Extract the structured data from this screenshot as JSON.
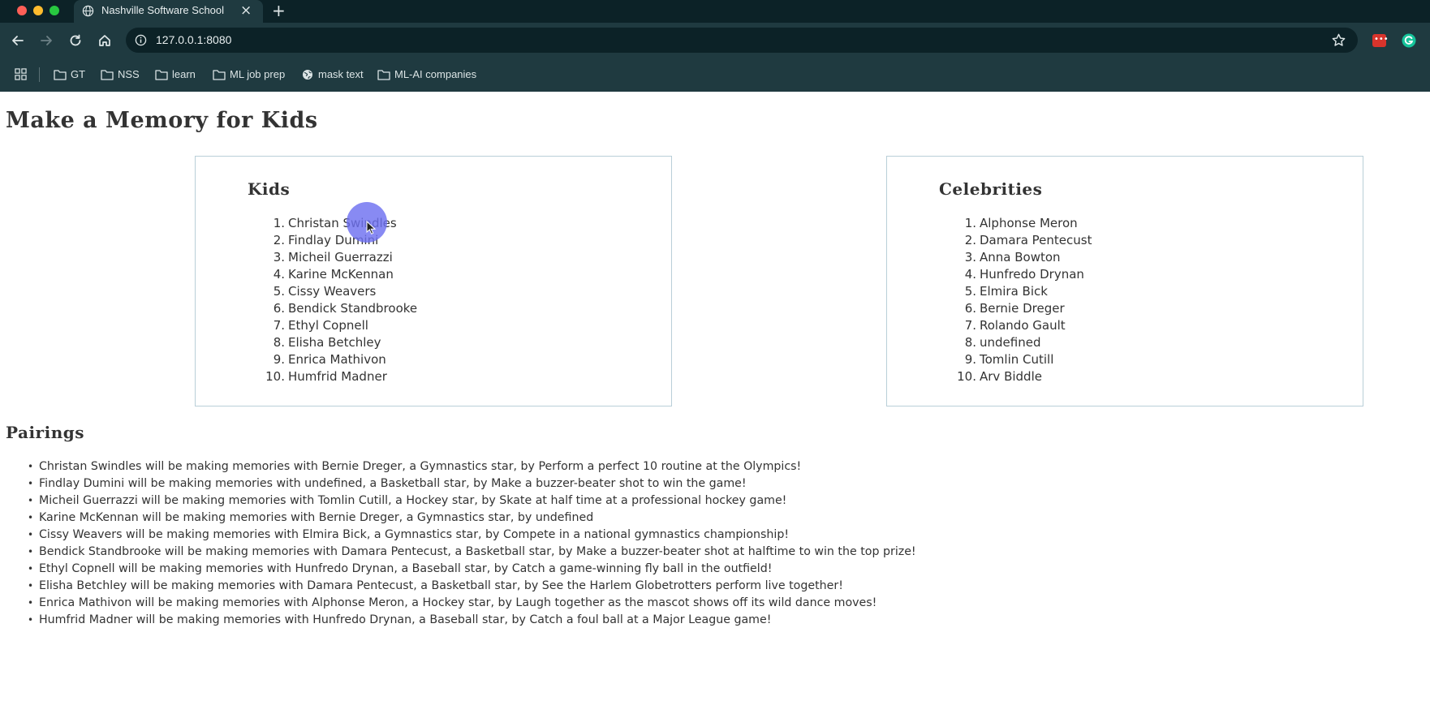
{
  "browser": {
    "tab": {
      "title": "Nashville Software School",
      "close_glyph": "×",
      "icon": "globe-icon"
    },
    "new_tab_glyph": "+",
    "address": {
      "url": "127.0.0.1:8080",
      "icon": "info-icon"
    },
    "bookmarks": [
      {
        "label": "GT",
        "icon": "folder-icon"
      },
      {
        "label": "NSS",
        "icon": "folder-icon"
      },
      {
        "label": "learn",
        "icon": "folder-icon"
      },
      {
        "label": "ML job prep",
        "icon": "folder-icon"
      },
      {
        "label": "mask text",
        "icon": "globe-icon"
      },
      {
        "label": "ML-AI companies",
        "icon": "folder-icon"
      }
    ],
    "extension_glyph": "•••"
  },
  "page": {
    "title": "Make a Memory for Kids",
    "kids": {
      "heading": "Kids",
      "items": [
        {
          "num": "1.",
          "name": "Christan Swindles"
        },
        {
          "num": "2.",
          "name": "Findlay Dumini"
        },
        {
          "num": "3.",
          "name": "Micheil Guerrazzi"
        },
        {
          "num": "4.",
          "name": "Karine McKennan"
        },
        {
          "num": "5.",
          "name": "Cissy Weavers"
        },
        {
          "num": "6.",
          "name": "Bendick Standbrooke"
        },
        {
          "num": "7.",
          "name": "Ethyl Copnell"
        },
        {
          "num": "8.",
          "name": "Elisha Betchley"
        },
        {
          "num": "9.",
          "name": "Enrica Mathivon"
        },
        {
          "num": "10.",
          "name": "Humfrid Madner"
        }
      ]
    },
    "celebrities": {
      "heading": "Celebrities",
      "items": [
        {
          "num": "1.",
          "name": "Alphonse Meron"
        },
        {
          "num": "2.",
          "name": "Damara Pentecust"
        },
        {
          "num": "3.",
          "name": "Anna Bowton"
        },
        {
          "num": "4.",
          "name": "Hunfredo Drynan"
        },
        {
          "num": "5.",
          "name": "Elmira Bick"
        },
        {
          "num": "6.",
          "name": "Bernie Dreger"
        },
        {
          "num": "7.",
          "name": "Rolando Gault"
        },
        {
          "num": "8.",
          "name": "undefined"
        },
        {
          "num": "9.",
          "name": "Tomlin Cutill"
        },
        {
          "num": "10.",
          "name": "Arv Biddle"
        }
      ]
    },
    "pairings": {
      "heading": "Pairings",
      "bullet": "•",
      "items": [
        "Christan Swindles will be making memories with Bernie Dreger, a Gymnastics star, by Perform a perfect 10 routine at the Olympics!",
        "Findlay Dumini will be making memories with undefined, a Basketball star, by Make a buzzer-beater shot to win the game!",
        "Micheil Guerrazzi will be making memories with Tomlin Cutill, a Hockey star, by Skate at half time at a professional hockey game!",
        "Karine McKennan will be making memories with Bernie Dreger, a Gymnastics star, by undefined",
        "Cissy Weavers will be making memories with Elmira Bick, a Gymnastics star, by Compete in a national gymnastics championship!",
        "Bendick Standbrooke will be making memories with Damara Pentecust, a Basketball star, by Make a buzzer-beater shot at halftime to win the top prize!",
        "Ethyl Copnell will be making memories with Hunfredo Drynan, a Baseball star, by Catch a game-winning fly ball in the outfield!",
        "Elisha Betchley will be making memories with Damara Pentecust, a Basketball star, by See the Harlem Globetrotters perform live together!",
        "Enrica Mathivon will be making memories with Alphonse Meron, a Hockey star, by Laugh together as the mascot shows off its wild dance moves!",
        "Humfrid Madner will be making memories with Hunfredo Drynan, a Baseball star, by Catch a foul ball at a Major League game!"
      ]
    }
  },
  "colors": {
    "chrome_dark": "#0c2227",
    "chrome_toolbar": "#1f3a40",
    "card_border": "#b9cfd8",
    "cursor_highlight": "#6e70f0",
    "text": "#333333"
  }
}
